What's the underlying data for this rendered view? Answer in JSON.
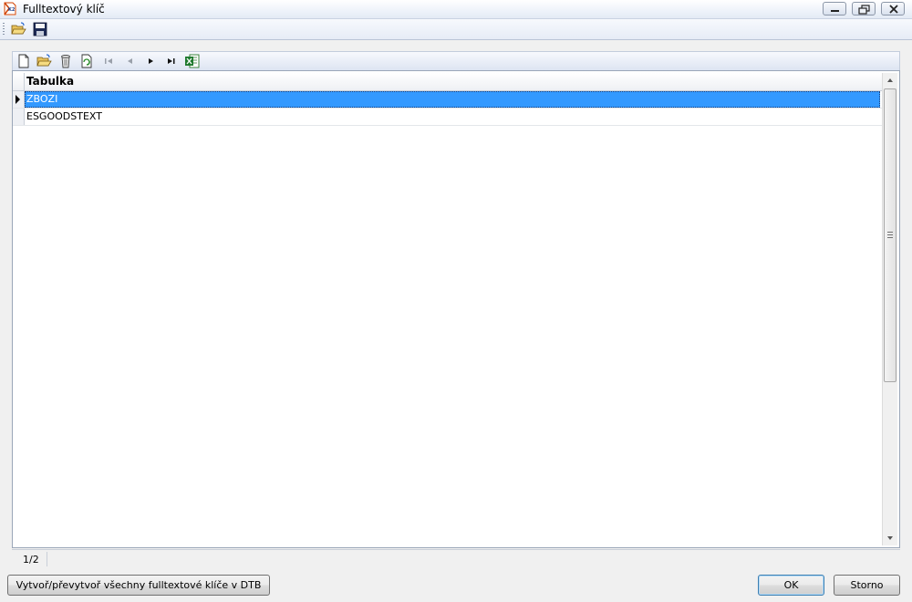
{
  "window": {
    "title": "Fulltextový klíč"
  },
  "main_toolbar": {
    "items": [
      {
        "name": "open-folder-icon"
      },
      {
        "name": "save-disk-icon"
      }
    ]
  },
  "navigator": {
    "items": [
      "new-record-icon",
      "open-record-icon",
      "delete-record-icon",
      "refresh-icon",
      "first-record-icon",
      "previous-record-icon",
      "next-record-icon",
      "last-record-icon",
      "excel-export-icon"
    ]
  },
  "grid": {
    "column_header": "Tabulka",
    "rows": [
      {
        "value": "ZBOZI",
        "selected": true
      },
      {
        "value": "ESGOODSTEXT",
        "selected": false
      }
    ],
    "selection_color": "#3399ff"
  },
  "status": {
    "record_position": "1/2"
  },
  "buttons": {
    "rebuild_label": "Vytvoř/převytvoř všechny fulltextové klíče v DTB",
    "ok_label": "OK",
    "cancel_label": "Storno"
  }
}
